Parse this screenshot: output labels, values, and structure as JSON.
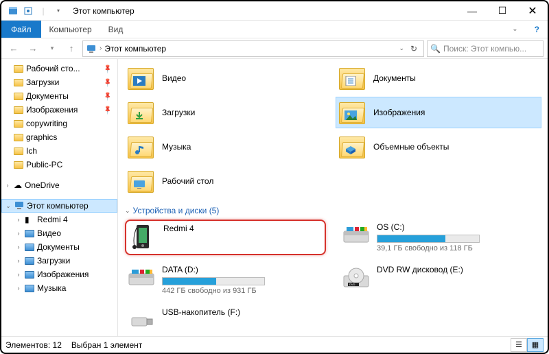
{
  "window": {
    "title": "Этот компьютер"
  },
  "menu": {
    "file": "Файл",
    "computer": "Компьютер",
    "view": "Вид"
  },
  "breadcrumb": {
    "root": "Этот компьютер"
  },
  "search": {
    "placeholder": "Поиск: Этот компью..."
  },
  "sidebar": {
    "quick": [
      {
        "label": "Рабочий сто...",
        "pin": true
      },
      {
        "label": "Загрузки",
        "pin": true
      },
      {
        "label": "Документы",
        "pin": true
      },
      {
        "label": "Изображения",
        "pin": true
      },
      {
        "label": "copywriting",
        "pin": false
      },
      {
        "label": "graphics",
        "pin": false
      },
      {
        "label": "Ich",
        "pin": false
      },
      {
        "label": "Public-PC",
        "pin": false
      }
    ],
    "onedrive": "OneDrive",
    "thispc": {
      "label": "Этот компьютер",
      "expanded": true,
      "children": [
        {
          "label": "Redmi 4"
        },
        {
          "label": "Видео"
        },
        {
          "label": "Документы"
        },
        {
          "label": "Загрузки"
        },
        {
          "label": "Изображения"
        },
        {
          "label": "Музыка"
        }
      ]
    }
  },
  "folders": [
    {
      "label": "Видео",
      "badge": "video"
    },
    {
      "label": "Документы",
      "badge": "doc"
    },
    {
      "label": "Загрузки",
      "badge": "download"
    },
    {
      "label": "Изображения",
      "badge": "image",
      "selected": true
    },
    {
      "label": "Музыка",
      "badge": "music"
    },
    {
      "label": "Объемные объекты",
      "badge": "3d"
    },
    {
      "label": "Рабочий стол",
      "badge": "desktop"
    }
  ],
  "devices_header": "Устройства и диски (5)",
  "devices": [
    {
      "name": "Redmi 4",
      "icon": "phone",
      "highlight": true
    },
    {
      "name": "OS (C:)",
      "icon": "drive",
      "bar_pct": 67,
      "sub": "39,1 ГБ свободно из 118 ГБ"
    },
    {
      "name": "DATA (D:)",
      "icon": "drive",
      "bar_pct": 53,
      "sub": "442 ГБ свободно из 931 ГБ"
    },
    {
      "name": "DVD RW дисковод (E:)",
      "icon": "dvd"
    },
    {
      "name": "USB-накопитель (F:)",
      "icon": "usb"
    }
  ],
  "status": {
    "count": "Элементов: 12",
    "selected": "Выбран 1 элемент"
  }
}
